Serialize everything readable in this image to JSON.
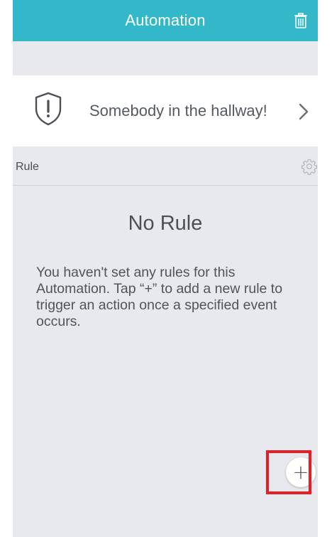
{
  "header": {
    "title": "Automation",
    "background_color": "#33b8c9",
    "trash_icon": "trash-icon"
  },
  "automation": {
    "name": "Somebody in the hallway!",
    "icon": "shield-alert-icon",
    "chevron_icon": "chevron-right-icon"
  },
  "rule_section": {
    "label": "Rule",
    "settings_icon": "gear-icon"
  },
  "empty_state": {
    "title": "No Rule",
    "description": "You haven't set any rules for this Automation. Tap “+” to add a new rule to trigger an action once a specified event occurs."
  },
  "add_button": {
    "label": "+",
    "highlight_color": "#e51f25"
  }
}
